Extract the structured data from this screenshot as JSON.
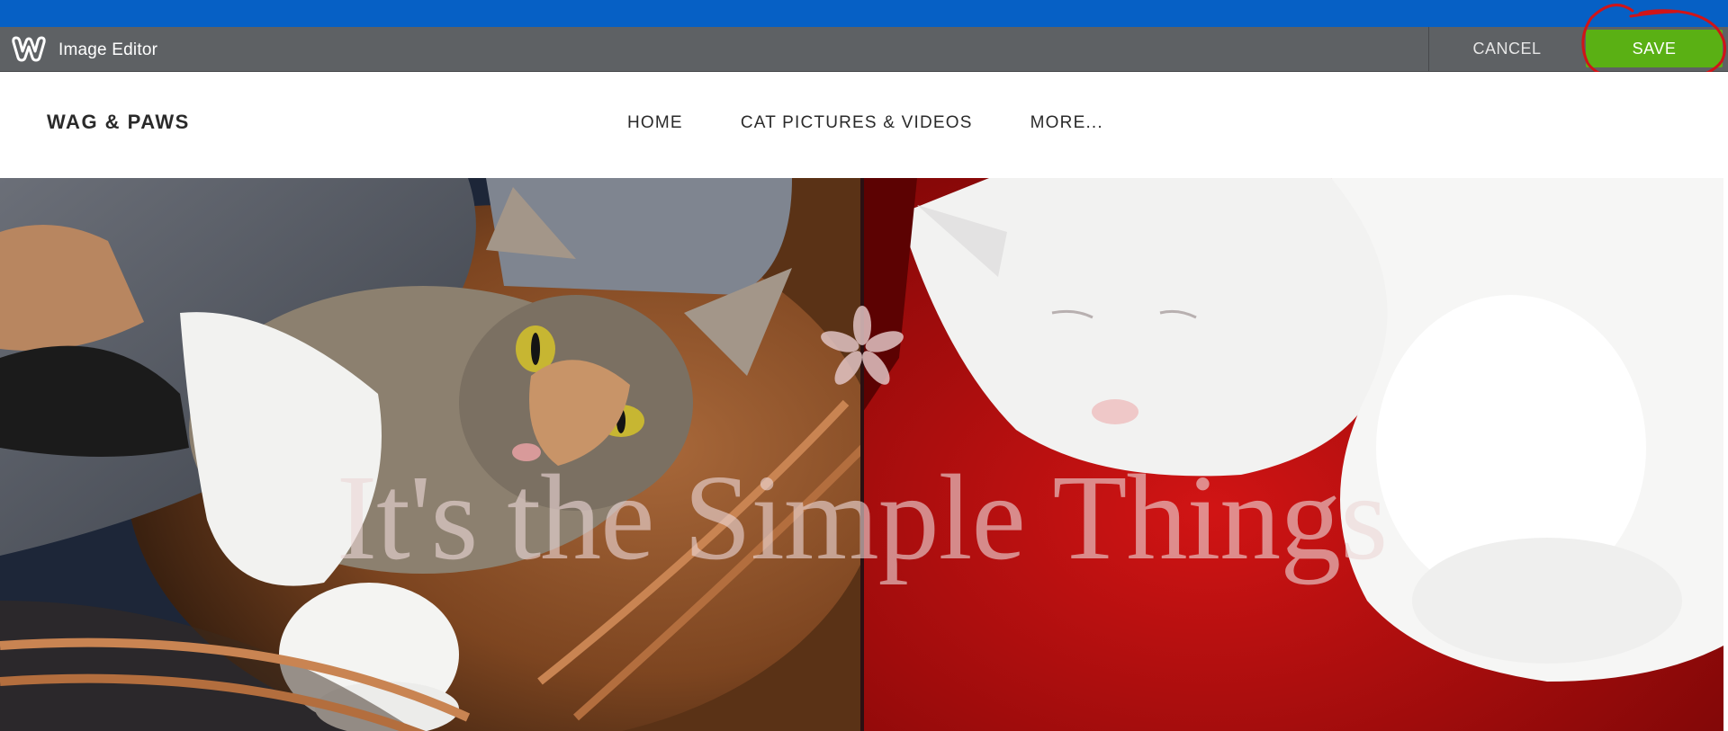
{
  "editor": {
    "logo_icon": "weebly-w-icon",
    "title": "Image Editor",
    "cancel_label": "CANCEL",
    "save_label": "SAVE"
  },
  "site": {
    "title": "WAG & PAWS",
    "nav": [
      {
        "label": "HOME"
      },
      {
        "label": "CAT PICTURES & VIDEOS"
      },
      {
        "label": "MORE..."
      }
    ]
  },
  "hero": {
    "star_icon": "asterisk-flower-icon",
    "headline": "It's the Simple Things",
    "left_image": "calico-cat-in-basket",
    "right_image": "white-cat-sleeping-on-red-blanket"
  },
  "colors": {
    "top_strip": "#0660c5",
    "editor_bar": "#5e6164",
    "save_green": "#5ab014",
    "annotation_red": "#d01418"
  }
}
